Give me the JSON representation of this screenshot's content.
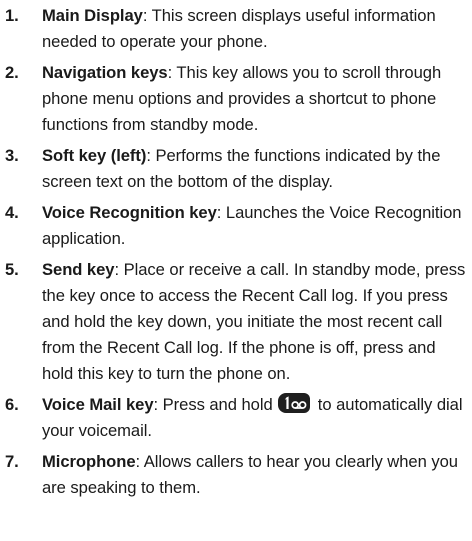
{
  "items": [
    {
      "number": "1.",
      "term": "Main Display",
      "text": ": This screen displays useful information needed to operate your phone."
    },
    {
      "number": "2.",
      "term": "Navigation keys",
      "text": ": This key allows you to scroll through phone menu options and provides a shortcut to phone functions from standby mode."
    },
    {
      "number": "3.",
      "term": "Soft key (left)",
      "text": ": Performs the functions indicated by the screen text on the bottom of the display."
    },
    {
      "number": "4.",
      "term": "Voice Recognition key",
      "text": ": Launches the Voice Recognition application."
    },
    {
      "number": "5.",
      "term": "Send key",
      "text": ": Place or receive a call. In standby mode, press the key once to access the Recent Call log. If you press and hold the key down, you initiate the most recent call from the Recent Call log. If the phone is off, press and hold this key to turn the phone on."
    },
    {
      "number": "6.",
      "term": "Voice Mail key",
      "text_before": ": Press and hold",
      "key_icon": "one-voicemail-key-icon",
      "text_after": "to automatically dial your voicemail."
    },
    {
      "number": "7.",
      "term": "Microphone",
      "text": ": Allows callers to hear you clearly when you are speaking to them."
    }
  ]
}
